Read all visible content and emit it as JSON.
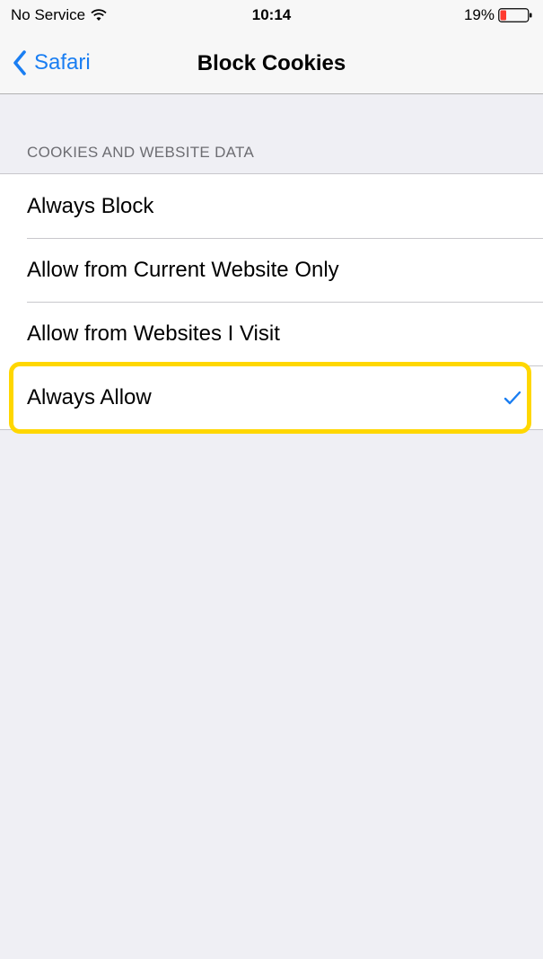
{
  "status_bar": {
    "carrier": "No Service",
    "time": "10:14",
    "battery": "19%"
  },
  "nav": {
    "back_label": "Safari",
    "title": "Block Cookies"
  },
  "section": {
    "header": "COOKIES AND WEBSITE DATA"
  },
  "options": [
    {
      "label": "Always Block",
      "selected": false
    },
    {
      "label": "Allow from Current Website Only",
      "selected": false
    },
    {
      "label": "Allow from Websites I Visit",
      "selected": false
    },
    {
      "label": "Always Allow",
      "selected": true
    }
  ],
  "colors": {
    "accent": "#1a7ef2",
    "highlight": "#ffd700",
    "background": "#efeff4"
  },
  "icons": {
    "wifi": "wifi-icon",
    "battery": "battery-icon",
    "back": "chevron-left-icon",
    "selected": "checkmark-icon"
  }
}
